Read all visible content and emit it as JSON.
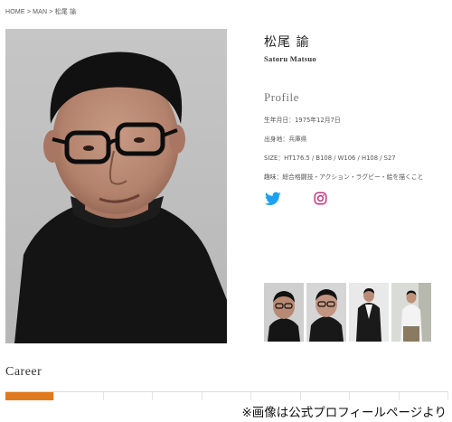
{
  "breadcrumb": {
    "home": "HOME",
    "sep1": ">",
    "man": "MAN",
    "sep2": ">",
    "current": "松尾 諭"
  },
  "profile_name": {
    "jp": "松尾 諭",
    "en": "Satoru Matsuo"
  },
  "profile": {
    "title": "Profile",
    "items": [
      {
        "label": "生年月日：",
        "value": "1975年12月7日"
      },
      {
        "label": "出身地：",
        "value": "兵庫県"
      },
      {
        "label": "SIZE：",
        "value": "HT176.5 / B108 / W106 / H108 / S27"
      },
      {
        "label": "趣味：",
        "value": "総合格闘技・アクション・ラグビー・絵を描くこと"
      }
    ]
  },
  "social": {
    "twitter_color": "#1da1f2",
    "instagram_color": "#c13584"
  },
  "thumbnail_count": 4,
  "career": {
    "title": "Career",
    "accent_color": "#e07a1f"
  },
  "caption": "※画像は公式プロフィールページより"
}
